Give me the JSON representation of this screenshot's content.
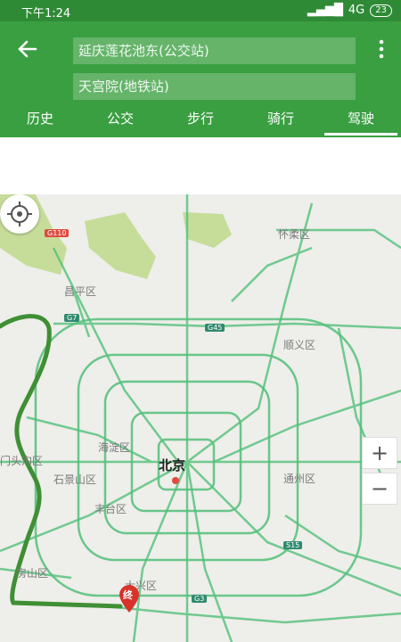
{
  "status": {
    "time": "下午1:24",
    "network": "4G",
    "battery": "23"
  },
  "route": {
    "origin": "延庆莲花池东(公交站)",
    "destination": "天宫院(地铁站)"
  },
  "tabs": [
    "历史",
    "公交",
    "步行",
    "骑行",
    "驾驶"
  ],
  "active_tab": "驾驶",
  "map": {
    "city": "北京",
    "labels": [
      "怀柔区",
      "昌平区",
      "顺义区",
      "海淀区",
      "石景山区",
      "丰台区",
      "通州区",
      "房山区",
      "大兴区",
      "门头沟区"
    ],
    "shields": [
      "G110",
      "G7",
      "G45",
      "S15",
      "G3"
    ],
    "end_marker": "终",
    "zoom_in": "+",
    "zoom_out": "−",
    "colors": {
      "route": "#3f8f35",
      "roads": "#52c07a",
      "green_area": "#c6dd9a"
    }
  }
}
